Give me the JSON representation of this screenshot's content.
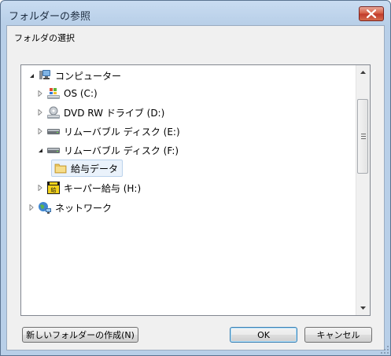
{
  "window": {
    "title": "フォルダーの参照"
  },
  "dialog": {
    "instruction": "フォルダの選択"
  },
  "tree": {
    "items": [
      {
        "label": "コンピューター",
        "icon": "computer-icon",
        "expander": "expanded"
      },
      {
        "label": "OS (C:)",
        "icon": "system-drive-icon",
        "expander": "collapsed"
      },
      {
        "label": "DVD RW ドライブ (D:)",
        "icon": "dvd-drive-icon",
        "expander": "collapsed"
      },
      {
        "label": "リムーバブル ディスク (E:)",
        "icon": "removable-disk-icon",
        "expander": "collapsed"
      },
      {
        "label": "リムーバブル ディスク (F:)",
        "icon": "removable-disk-icon",
        "expander": "expanded"
      },
      {
        "label": "給与データ",
        "icon": "folder-icon",
        "expander": "none",
        "selected": true
      },
      {
        "label": "キーパー給与 (H:)",
        "icon": "keeper-drive-icon",
        "expander": "collapsed"
      },
      {
        "label": "ネットワーク",
        "icon": "network-icon",
        "expander": "collapsed"
      }
    ]
  },
  "buttons": {
    "new_folder": "新しいフォルダーの作成(N)",
    "ok": "OK",
    "cancel": "キャンセル"
  },
  "colors": {
    "selection_bg": "#eaf2fb",
    "selection_border": "#bad2ec",
    "close_red": "#c0392b"
  }
}
